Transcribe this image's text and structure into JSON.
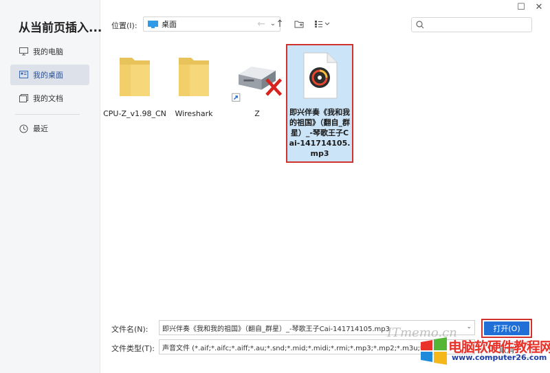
{
  "window": {
    "title": "从当前页插入...",
    "minimize_glyph": "☐",
    "close_glyph": "✕"
  },
  "sidebar": {
    "items": [
      {
        "label": "我的电脑",
        "icon": "computer-icon"
      },
      {
        "label": "我的桌面",
        "icon": "desktop-icon",
        "active": true
      },
      {
        "label": "我的文档",
        "icon": "documents-icon"
      },
      {
        "label": "最近",
        "icon": "recent-clock-icon"
      }
    ]
  },
  "toolbar": {
    "location_label": "位置(I):",
    "location_value": "桌面",
    "chevron_glyph": "⌄",
    "back_glyph": "←",
    "up_glyph": "↑",
    "new_folder_glyph": "+",
    "view_glyph": "☷⌄"
  },
  "files": [
    {
      "name": "CPU-Z_v1.98_CN",
      "type": "folder"
    },
    {
      "name": "Wireshark",
      "type": "folder"
    },
    {
      "name": "Z",
      "type": "network-drive-disconnected"
    },
    {
      "name": "即兴伴奏《我和我的祖国》（翻自_群星）_-琴歌王子Cai-141714105.mp3",
      "type": "mp3",
      "selected": true
    }
  ],
  "bottom": {
    "filename_label": "文件名(N):",
    "filename_value": "即兴伴奏《我和我的祖国》（翻自_群星）_-琴歌王子Cai-141714105.mp3",
    "filetype_label": "文件类型(T):",
    "filetype_value": "声音文件 (*.aif;*.aifc;*.aiff;*.au;*.snd;*.mid;*.midi;*.rmi;*.mp3;*.mp2;*.m3u;*.m",
    "open_label": "打开(O)",
    "cancel_label": "取消",
    "dropdown_glyph": "⌄"
  },
  "watermark": {
    "site_text": "ITmemo.cn",
    "cn_text": "电脑软硬件教程网",
    "url": "www.computer26.com"
  },
  "colors": {
    "accent": "#1f6fd6",
    "highlight_border": "#d0312d",
    "selection_bg": "#cce4f7",
    "folder": "#f6d77a"
  }
}
